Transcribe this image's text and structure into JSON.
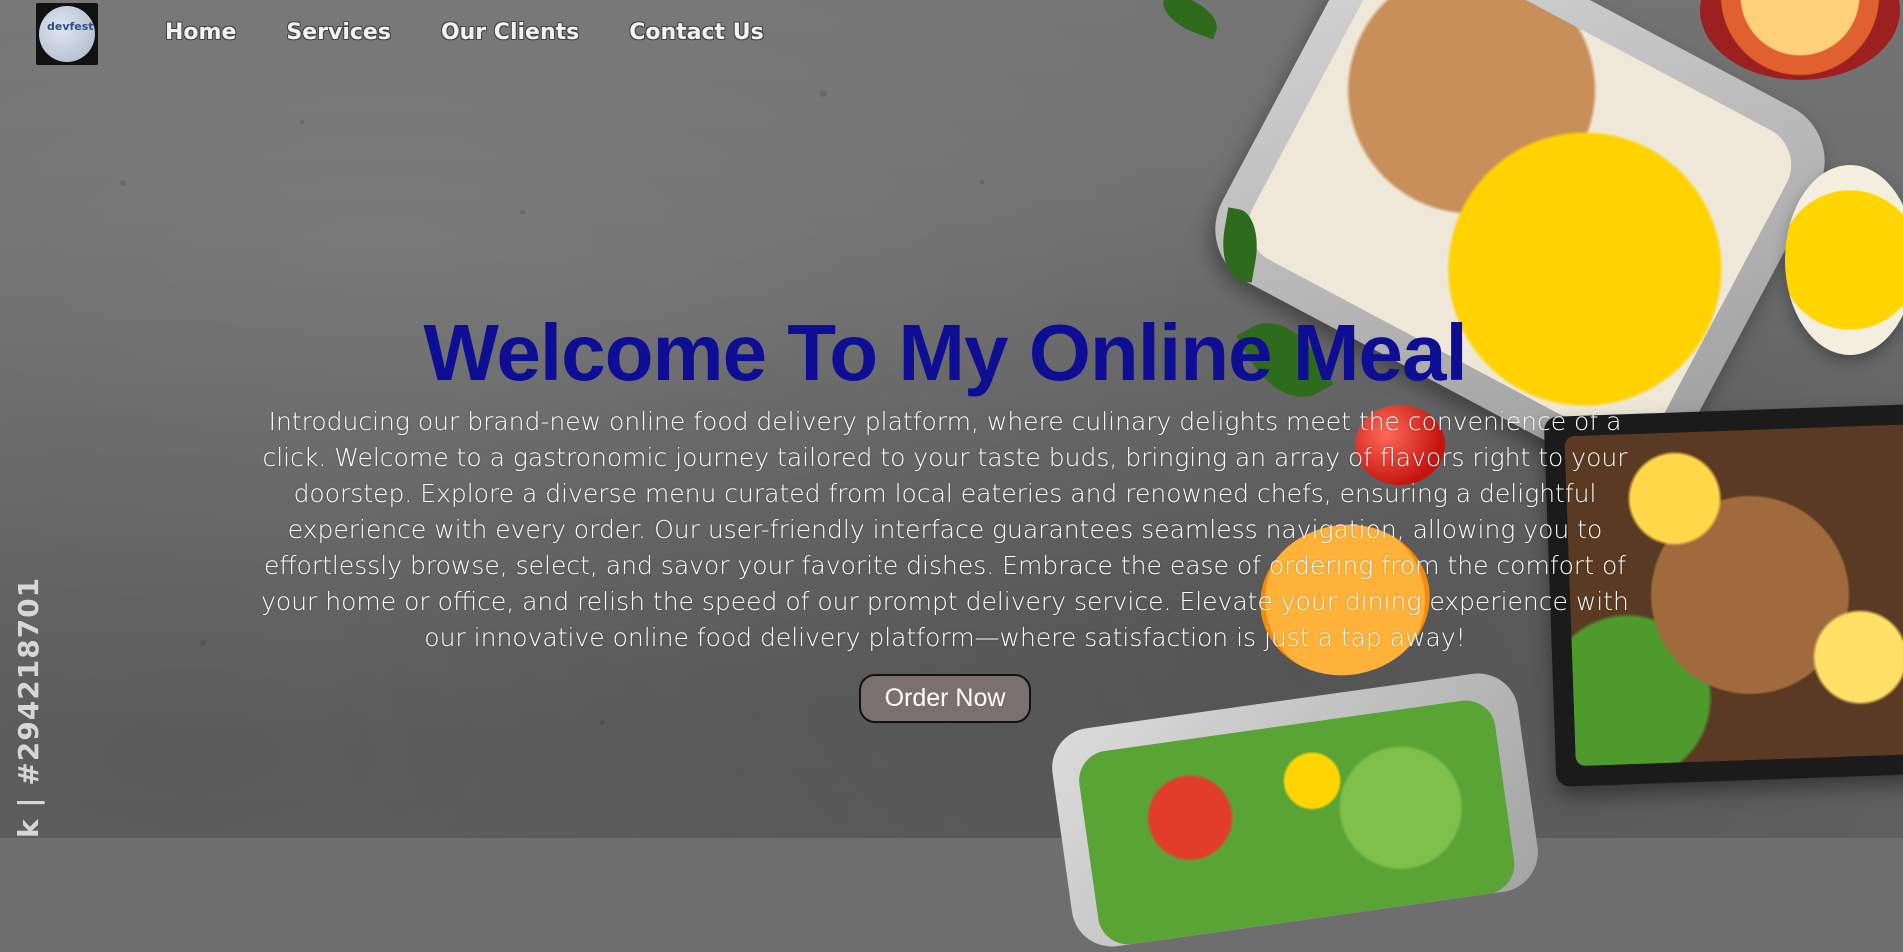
{
  "logo": {
    "alt": "devfest logo",
    "text": "devfest"
  },
  "nav": {
    "items": [
      {
        "label": "Home"
      },
      {
        "label": "Services"
      },
      {
        "label": "Our Clients"
      },
      {
        "label": "Contact Us"
      }
    ]
  },
  "hero": {
    "title": "Welcome To My Online Meal",
    "paragraph": "Introducing our brand-new online food delivery platform, where culinary delights meet the convenience of a click. Welcome to a gastronomic journey tailored to your taste buds, bringing an array of flavors right to your doorstep. Explore a diverse menu curated from local eateries and renowned chefs, ensuring a delightful experience with every order. Our user-friendly interface guarantees seamless navigation, allowing you to effortlessly browse, select, and savor your favorite dishes. Embrace the ease of ordering from the comfort of your home or office, and relish the speed of our prompt delivery service. Elevate your dining experience with our innovative online food delivery platform—where satisfaction is just a tap away!",
    "button_label": "Order Now"
  },
  "watermark": "k | #294218701",
  "colors": {
    "title": "#0d0e93",
    "button_bg": "#7b7070",
    "nav_text": "#f2f2f2"
  }
}
